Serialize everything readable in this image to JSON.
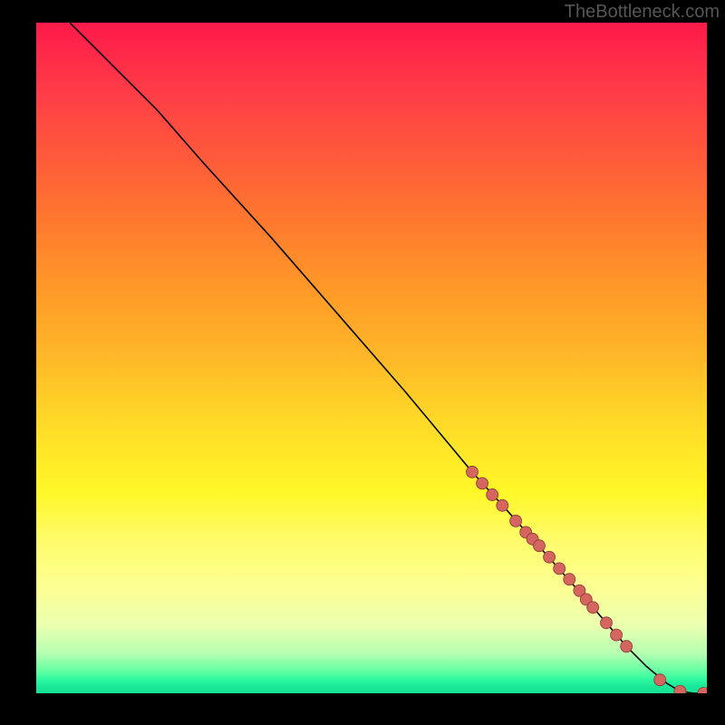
{
  "watermark": "TheBottleneck.com",
  "chart_data": {
    "type": "line",
    "title": "",
    "xlabel": "",
    "ylabel": "",
    "xlim": [
      0,
      100
    ],
    "ylim": [
      0,
      100
    ],
    "series": [
      {
        "name": "curve",
        "x": [
          5,
          8,
          12,
          18,
          25,
          35,
          45,
          55,
          65,
          70,
          74,
          78,
          82,
          85,
          88,
          91,
          94,
          96,
          98,
          100
        ],
        "y": [
          100,
          97,
          93,
          87,
          79,
          68,
          56.5,
          45,
          33,
          27.5,
          23,
          18.5,
          14,
          10.5,
          7,
          4,
          1.5,
          0.3,
          0,
          0
        ]
      }
    ],
    "markers": {
      "name": "points",
      "x": [
        65,
        66.5,
        68,
        69.5,
        71.5,
        73,
        74,
        75,
        76.5,
        78,
        79.5,
        81,
        82,
        83,
        85,
        86.5,
        88,
        93,
        96,
        99.5
      ],
      "y": [
        33,
        31.3,
        29.6,
        28,
        25.7,
        24,
        23,
        22,
        20.3,
        18.6,
        17,
        15.3,
        14,
        12.8,
        10.5,
        8.7,
        7,
        2,
        0.3,
        0
      ]
    }
  },
  "colors": {
    "curve": "#000000",
    "marker_fill": "#d4665f",
    "marker_stroke": "#8a3a36"
  }
}
